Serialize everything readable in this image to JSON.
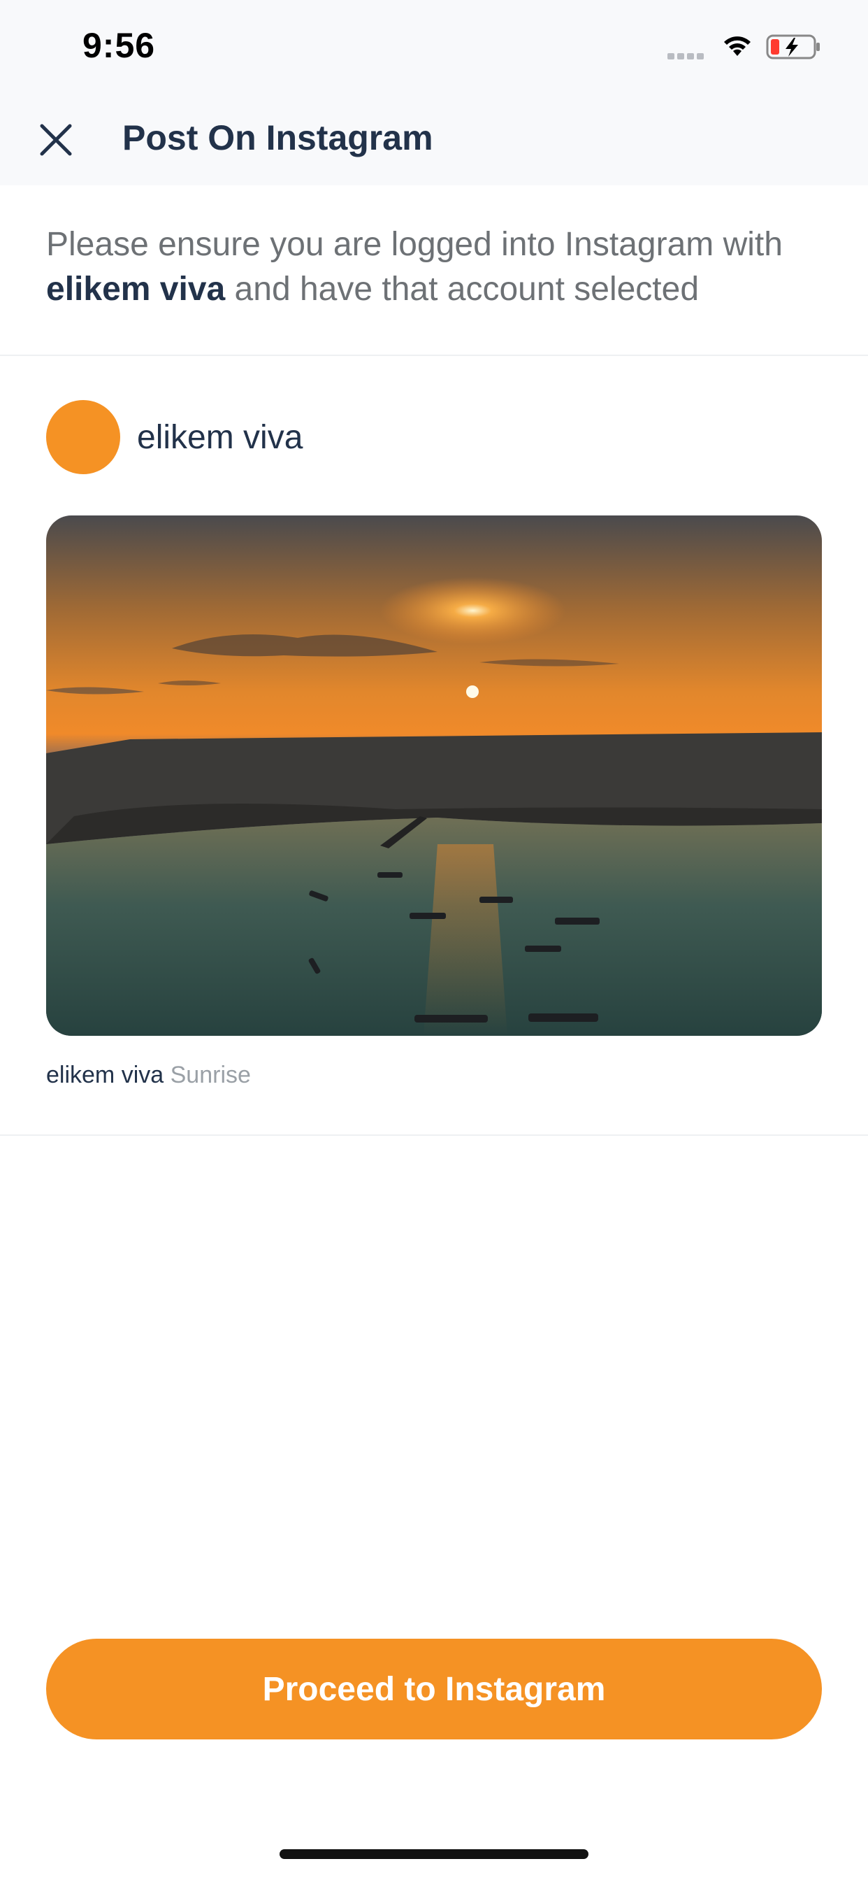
{
  "status_bar": {
    "time": "9:56"
  },
  "header": {
    "title": "Post On Instagram",
    "close_icon": "close-icon"
  },
  "instruction": {
    "prefix": "Please ensure you are logged into Instagram with",
    "account": "elikem viva",
    "suffix": "and have that account selected"
  },
  "account": {
    "name": "elikem viva",
    "avatar_color": "#f59224"
  },
  "post": {
    "image_description": "aerial sunset over coastal town with boats",
    "caption_user": "elikem viva",
    "caption_text": "Sunrise"
  },
  "actions": {
    "proceed_label": "Proceed to Instagram"
  },
  "colors": {
    "accent": "#f59224",
    "title": "#22324a",
    "muted": "#6d7175"
  }
}
